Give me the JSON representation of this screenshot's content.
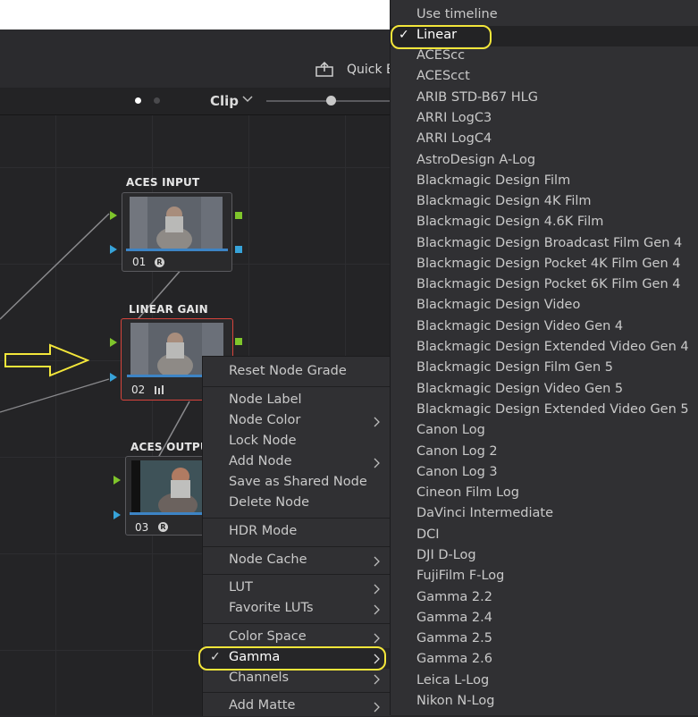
{
  "toolbar": {
    "quick_export_label": "Quick E",
    "view_dots": [
      "active",
      "inactive"
    ],
    "clip_label": "Clip"
  },
  "nodes": [
    {
      "title": "ACES INPUT",
      "number": "01",
      "icon": "aces-badge-icon"
    },
    {
      "title": "LINEAR GAIN",
      "number": "02",
      "icon": "levels-icon"
    },
    {
      "title": "ACES OUTPUT",
      "number": "03",
      "icon": "aces-badge-icon"
    }
  ],
  "context_menu": {
    "items": [
      {
        "label": "Reset Node Grade",
        "submenu": false
      },
      {
        "label": "Node Label",
        "submenu": false
      },
      {
        "label": "Node Color",
        "submenu": true
      },
      {
        "label": "Lock Node",
        "submenu": false
      },
      {
        "label": "Add Node",
        "submenu": true
      },
      {
        "label": "Save as Shared Node",
        "submenu": false
      },
      {
        "label": "Delete Node",
        "submenu": false
      },
      {
        "label": "HDR Mode",
        "submenu": false
      },
      {
        "label": "Node Cache",
        "submenu": true
      },
      {
        "label": "LUT",
        "submenu": true
      },
      {
        "label": "Favorite LUTs",
        "submenu": true
      },
      {
        "label": "Color Space",
        "submenu": true
      },
      {
        "label": "Gamma",
        "submenu": true,
        "checked": true
      },
      {
        "label": "Channels",
        "submenu": true
      },
      {
        "label": "Add Matte",
        "submenu": true
      }
    ]
  },
  "gamma_menu": {
    "selected": "Linear",
    "items": [
      "Use timeline",
      "Linear",
      "ACEScc",
      "ACEScct",
      "ARIB STD-B67 HLG",
      "ARRI LogC3",
      "ARRI LogC4",
      "AstroDesign A-Log",
      "Blackmagic Design Film",
      "Blackmagic Design 4K Film",
      "Blackmagic Design 4.6K Film",
      "Blackmagic Design Broadcast Film Gen 4",
      "Blackmagic Design Pocket 4K Film Gen 4",
      "Blackmagic Design Pocket 6K Film Gen 4",
      "Blackmagic Design Video",
      "Blackmagic Design Video Gen 4",
      "Blackmagic Design Extended Video Gen 4",
      "Blackmagic Design Film Gen 5",
      "Blackmagic Design Video Gen 5",
      "Blackmagic Design Extended Video Gen 5",
      "Canon Log",
      "Canon Log 2",
      "Canon Log 3",
      "Cineon Film Log",
      "DaVinci Intermediate",
      "DCI",
      "DJI D-Log",
      "FujiFilm F-Log",
      "Gamma 2.2",
      "Gamma 2.4",
      "Gamma 2.5",
      "Gamma 2.6",
      "Leica L-Log",
      "Nikon N-Log"
    ]
  },
  "colors": {
    "annotation_yellow": "#f3e63a",
    "selected_node_border": "#d7443c",
    "port_green": "#7fc52b",
    "port_blue": "#37a3d9"
  }
}
